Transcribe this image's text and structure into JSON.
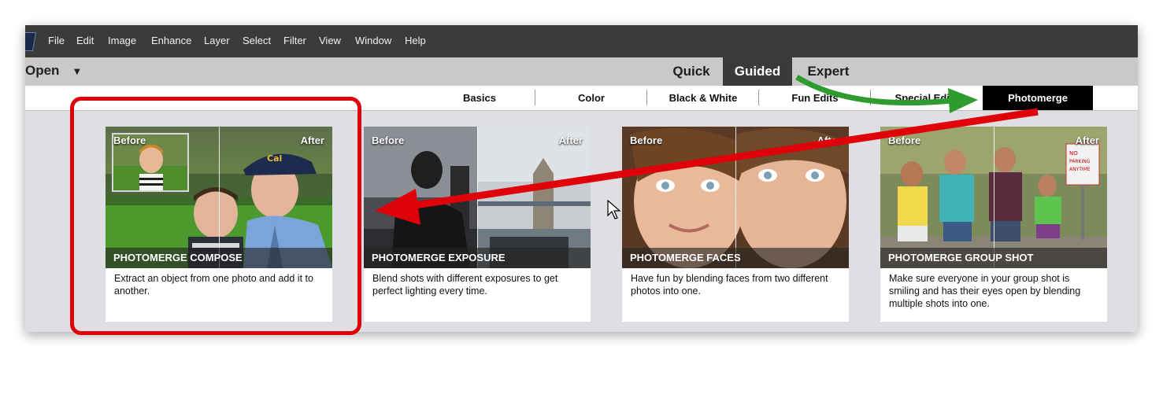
{
  "menubar": {
    "items": [
      "File",
      "Edit",
      "Image",
      "Enhance",
      "Layer",
      "Select",
      "Filter",
      "View",
      "Window",
      "Help"
    ]
  },
  "modebar": {
    "open_label": "Open",
    "modes": [
      {
        "label": "Quick",
        "active": false
      },
      {
        "label": "Guided",
        "active": true
      },
      {
        "label": "Expert",
        "active": false
      }
    ]
  },
  "tabs": {
    "items": [
      {
        "label": "Basics",
        "active": false
      },
      {
        "label": "Color",
        "active": false
      },
      {
        "label": "Black & White",
        "active": false
      },
      {
        "label": "Fun Edits",
        "active": false
      },
      {
        "label": "Special Edits",
        "active": false
      },
      {
        "label": "Photomerge",
        "active": true
      }
    ]
  },
  "cards": [
    {
      "before": "Before",
      "after": "After",
      "title": "PHOTOMERGE COMPOSE",
      "description": "Extract an object from one photo and add it to another."
    },
    {
      "before": "Before",
      "after": "After",
      "title": "PHOTOMERGE EXPOSURE",
      "description": "Blend shots with different exposures to get perfect lighting every time."
    },
    {
      "before": "Before",
      "after": "After",
      "title": "PHOTOMERGE FACES",
      "description": "Have fun by blending faces from two different photos into one."
    },
    {
      "before": "Before",
      "after": "After",
      "title": "PHOTOMERGE GROUP SHOT",
      "description": "Make sure everyone in your group shot is smiling and has their eyes open by blending multiple shots into one."
    }
  ],
  "annotations": {
    "green_arrow_color": "#2e9b2e",
    "red_arrow_color": "#e0000a",
    "highlight_color": "#e0000a"
  },
  "icons": {
    "app_logo": "app-logo-icon",
    "open_caret": "chevron-down-icon",
    "cursor": "mouse-pointer-icon"
  }
}
